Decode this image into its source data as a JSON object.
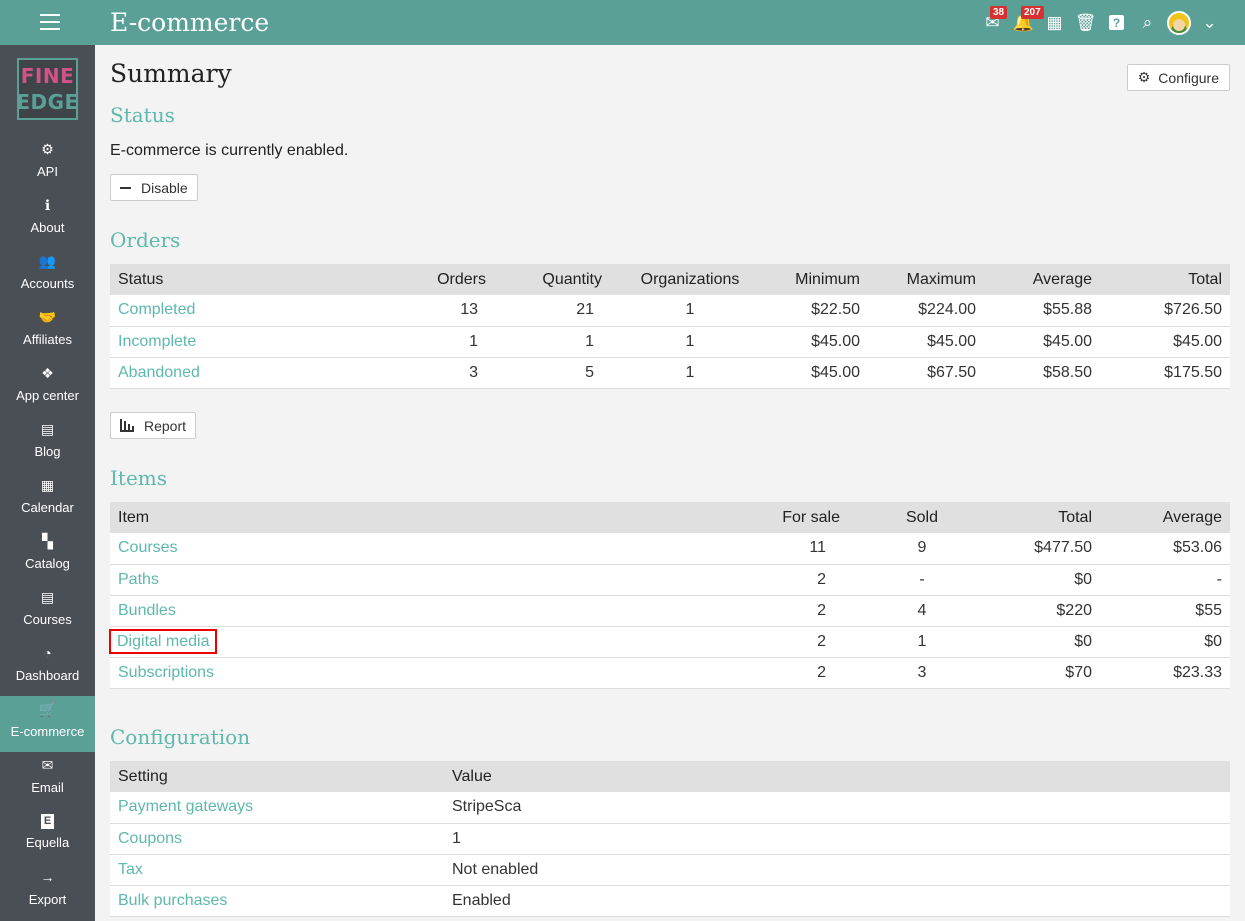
{
  "header": {
    "title": "E-commerce",
    "mail_badge": "38",
    "notif_badge": "207"
  },
  "logo": {
    "line1": "FINE",
    "line2": "EDGE"
  },
  "sidebar": {
    "items": [
      {
        "label": "API",
        "icon": "⚙"
      },
      {
        "label": "About",
        "icon": "ℹ"
      },
      {
        "label": "Accounts",
        "icon": "👥"
      },
      {
        "label": "Affiliates",
        "icon": "🤝"
      },
      {
        "label": "App center",
        "icon": "❖"
      },
      {
        "label": "Blog",
        "icon": "▤"
      },
      {
        "label": "Calendar",
        "icon": "▦"
      },
      {
        "label": "Catalog",
        "icon": "▚"
      },
      {
        "label": "Courses",
        "icon": "▤"
      },
      {
        "label": "Dashboard",
        "icon": "◔"
      },
      {
        "label": "E-commerce",
        "icon": "🛒"
      },
      {
        "label": "Email",
        "icon": "✉"
      },
      {
        "label": "Equella",
        "icon": "E"
      },
      {
        "label": "Export",
        "icon": "→"
      }
    ]
  },
  "page": {
    "title": "Summary",
    "configure_label": "Configure"
  },
  "status": {
    "heading": "Status",
    "text": "E-commerce is currently enabled.",
    "disable_label": "Disable"
  },
  "orders": {
    "heading": "Orders",
    "columns": [
      "Status",
      "Orders",
      "Quantity",
      "Organizations",
      "Minimum",
      "Maximum",
      "Average",
      "Total"
    ],
    "rows": [
      [
        "Completed",
        "13",
        "21",
        "1",
        "$22.50",
        "$224.00",
        "$55.88",
        "$726.50"
      ],
      [
        "Incomplete",
        "1",
        "1",
        "1",
        "$45.00",
        "$45.00",
        "$45.00",
        "$45.00"
      ],
      [
        "Abandoned",
        "3",
        "5",
        "1",
        "$45.00",
        "$67.50",
        "$58.50",
        "$175.50"
      ]
    ],
    "report_label": "Report"
  },
  "items": {
    "heading": "Items",
    "columns": [
      "Item",
      "For sale",
      "Sold",
      "Total",
      "Average"
    ],
    "rows": [
      [
        "Courses",
        "11",
        "9",
        "$477.50",
        "$53.06"
      ],
      [
        "Paths",
        "2",
        "-",
        "$0",
        "-"
      ],
      [
        "Bundles",
        "2",
        "4",
        "$220",
        "$55"
      ],
      [
        "Digital media",
        "2",
        "1",
        "$0",
        "$0"
      ],
      [
        "Subscriptions",
        "2",
        "3",
        "$70",
        "$23.33"
      ]
    ]
  },
  "configuration": {
    "heading": "Configuration",
    "columns": [
      "Setting",
      "Value"
    ],
    "rows": [
      [
        "Payment gateways",
        "StripeSca"
      ],
      [
        "Coupons",
        "1"
      ],
      [
        "Tax",
        "Not enabled"
      ],
      [
        "Bulk purchases",
        "Enabled"
      ]
    ]
  },
  "colors": {
    "accent": "#5aa097",
    "link": "#5db8ad",
    "sidebar": "#4a4f55",
    "badge": "#d63031",
    "highlight": "#e00000"
  }
}
